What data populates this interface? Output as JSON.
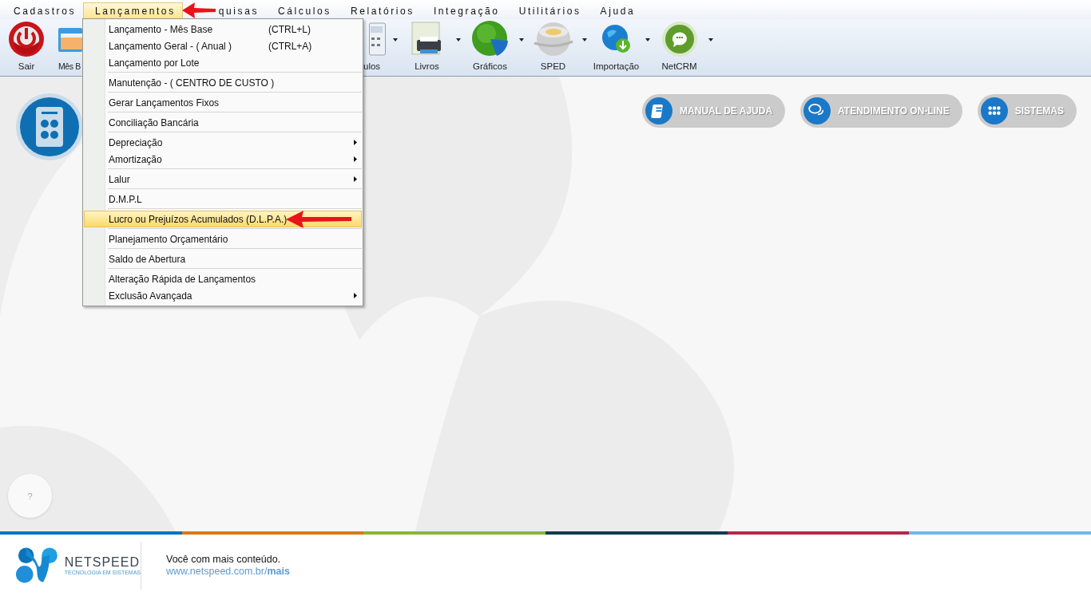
{
  "menu_bar": [
    {
      "label": "Cadastros",
      "selected": false
    },
    {
      "label": "Lançamentos",
      "selected": true
    },
    {
      "label": "quisas",
      "selected": false
    },
    {
      "label": "Cálculos",
      "selected": false
    },
    {
      "label": "Relatórios",
      "selected": false
    },
    {
      "label": "Integração",
      "selected": false
    },
    {
      "label": "Utilitários",
      "selected": false
    },
    {
      "label": "Ajuda",
      "selected": false
    }
  ],
  "toolbar": [
    {
      "label": "Sair",
      "kind": "power",
      "dropdown": false
    },
    {
      "label": "Mês B",
      "kind": "calendar",
      "dropdown": false
    },
    {
      "label": "ulos",
      "kind": "calculator",
      "dropdown": true
    },
    {
      "label": "Livros",
      "kind": "printer",
      "dropdown": true
    },
    {
      "label": "Gráficos",
      "kind": "pie",
      "dropdown": true
    },
    {
      "label": "SPED",
      "kind": "disc",
      "dropdown": true
    },
    {
      "label": "Importação",
      "kind": "globe",
      "dropdown": true
    },
    {
      "label": "NetCRM",
      "kind": "chat",
      "dropdown": true
    }
  ],
  "dropdown_menu": [
    [
      {
        "label": "Lançamento - Mês Base",
        "shortcut": "(CTRL+L)",
        "submenu": false,
        "selected": false
      },
      {
        "label": "Lançamento Geral - ( Anual )",
        "shortcut": "(CTRL+A)",
        "submenu": false,
        "selected": false
      },
      {
        "label": "Lançamento por Lote",
        "submenu": false,
        "selected": false
      }
    ],
    [
      {
        "label": "Manutenção - ( CENTRO DE CUSTO )",
        "submenu": false,
        "selected": false
      }
    ],
    [
      {
        "label": "Gerar Lançamentos Fixos",
        "submenu": false,
        "selected": false
      }
    ],
    [
      {
        "label": "Conciliação Bancária",
        "submenu": false,
        "selected": false
      }
    ],
    [
      {
        "label": "Depreciação",
        "submenu": true,
        "selected": false
      },
      {
        "label": "Amortização",
        "submenu": true,
        "selected": false
      }
    ],
    [
      {
        "label": "Lalur",
        "submenu": true,
        "selected": false
      }
    ],
    [
      {
        "label": "D.M.P.L",
        "submenu": false,
        "selected": false
      }
    ],
    [
      {
        "label": "Lucro ou Prejuízos Acumulados (D.L.P.A.)",
        "submenu": false,
        "selected": true
      }
    ],
    [
      {
        "label": "Planejamento Orçamentário",
        "submenu": false,
        "selected": false
      }
    ],
    [
      {
        "label": "Saldo de Abertura",
        "submenu": false,
        "selected": false
      }
    ],
    [
      {
        "label": "Alteração Rápida de Lançamentos",
        "submenu": false,
        "selected": false
      },
      {
        "label": "Exclusão Avançada",
        "submenu": true,
        "selected": false
      }
    ]
  ],
  "help_buttons": [
    {
      "label": "MANUAL DE AJUDA",
      "kind": "book"
    },
    {
      "label": "ATENDIMENTO ON-LINE",
      "kind": "chat"
    },
    {
      "label": "SISTEMAS",
      "kind": "grid"
    }
  ],
  "help_bubble": "?",
  "color_stripe": [
    {
      "color": "#0b73b9"
    },
    {
      "color": "#d67a1e"
    },
    {
      "color": "#8cb43a"
    },
    {
      "color": "#123c4e"
    },
    {
      "color": "#b02a4b"
    },
    {
      "color": "#71b9ea"
    }
  ],
  "footer": {
    "brand": "NETSPEED",
    "tagline": "TECNOLOGIA EM SISTEMAS",
    "slogan": "Você com mais conteúdo.",
    "link": "www.netspeed.com.br/**mais**"
  }
}
